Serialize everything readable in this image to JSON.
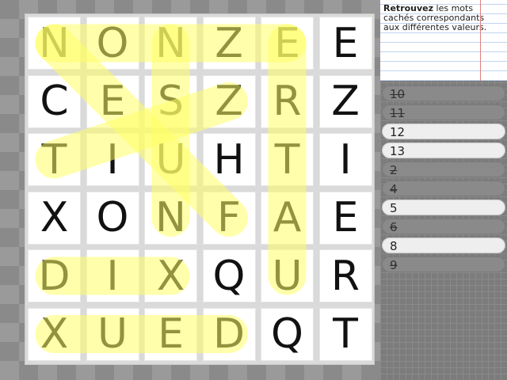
{
  "grid": [
    [
      "N",
      "O",
      "N",
      "Z",
      "E",
      "E"
    ],
    [
      "C",
      "E",
      "S",
      "Z",
      "R",
      "Z"
    ],
    [
      "T",
      "I",
      "U",
      "H",
      "T",
      "I"
    ],
    [
      "X",
      "O",
      "N",
      "F",
      "A",
      "E"
    ],
    [
      "D",
      "I",
      "X",
      "Q",
      "U",
      "R"
    ],
    [
      "X",
      "U",
      "E",
      "D",
      "Q",
      "T"
    ]
  ],
  "highlight_color": "#ffff66",
  "instructions": {
    "bold": "Retrouvez",
    "text": " les mots cachés correspondants aux différentes valeurs."
  },
  "values": [
    {
      "label": "10",
      "found": true
    },
    {
      "label": "11",
      "found": true
    },
    {
      "label": "12",
      "found": false
    },
    {
      "label": "13",
      "found": false
    },
    {
      "label": "2",
      "found": true
    },
    {
      "label": "4",
      "found": true
    },
    {
      "label": "5",
      "found": false
    },
    {
      "label": "6",
      "found": true
    },
    {
      "label": "8",
      "found": false
    },
    {
      "label": "9",
      "found": true
    }
  ]
}
